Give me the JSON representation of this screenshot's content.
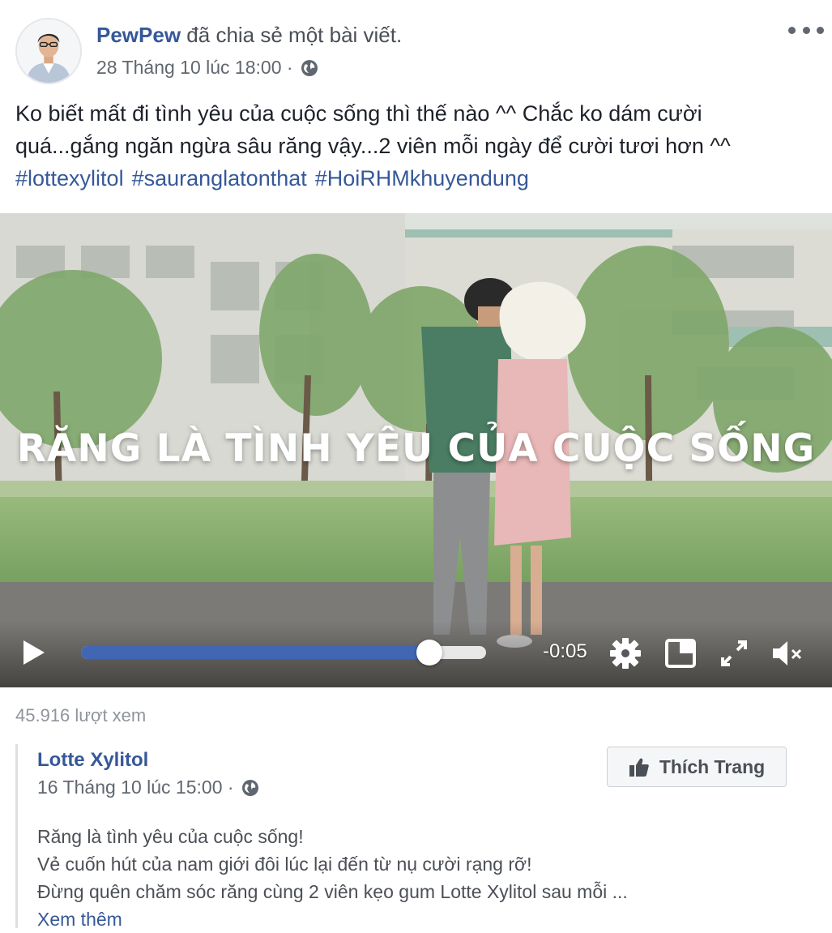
{
  "post": {
    "author": "PewPew",
    "action": "đã chia sẻ một bài viết.",
    "timestamp": "28 Tháng 10 lúc 18:00 ·",
    "privacy_icon": "globe-icon",
    "more_icon": "more-options-icon",
    "text_line1": "Ko biết mất đi tình yêu của cuộc sống thì thế nào ^^ Chắc ko dám cười",
    "text_line2": "quá...gắng ngăn ngừa sâu răng vậy...2 viên mỗi ngày để cười tươi hơn ^^",
    "hashtags": [
      "#lottexylitol",
      "#sauranglatonthat",
      "#HoiRHMkhuyendung"
    ]
  },
  "video": {
    "caption": "RĂNG LÀ TÌNH YÊU CỦA CUỘC SỐNG",
    "time_remaining": "-0:05",
    "progress": 0.86,
    "accent_color": "#4267b2",
    "icons": [
      "play-icon",
      "settings-icon",
      "picture-in-picture-icon",
      "fullscreen-icon",
      "muted-icon"
    ]
  },
  "stats": {
    "views": "45.916 lượt xem"
  },
  "shared": {
    "page_name": "Lotte Xylitol",
    "timestamp": "16 Tháng 10 lúc 15:00 ·",
    "like_button": "Thích Trang",
    "like_icon": "thumbs-up-icon",
    "line1": "Răng là tình yêu của cuộc sống!",
    "line2": "Vẻ cuốn hút của nam giới đôi lúc lại đến từ nụ cười rạng rỡ!",
    "line3": "Đừng quên chăm sóc răng cùng 2 viên kẹo gum Lotte Xylitol sau mỗi ...",
    "see_more": "Xem thêm"
  },
  "colors": {
    "link": "#365899",
    "secondary_text": "#616770",
    "muted_text": "#90949c"
  }
}
